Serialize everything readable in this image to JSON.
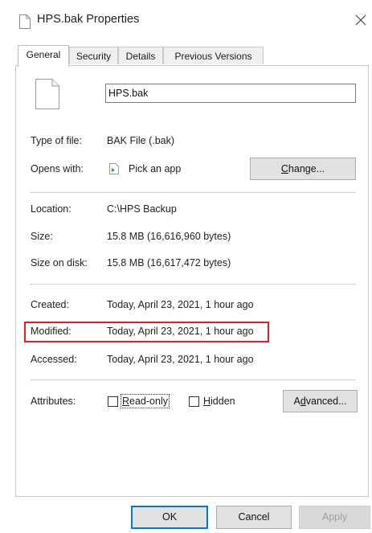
{
  "window": {
    "title": "HPS.bak Properties",
    "file_icon": "document-icon",
    "close_glyph": "✕"
  },
  "tabs": [
    {
      "label": "General",
      "active": true
    },
    {
      "label": "Security",
      "active": false
    },
    {
      "label": "Details",
      "active": false
    },
    {
      "label": "Previous Versions",
      "active": false
    }
  ],
  "general": {
    "filename": "HPS.bak",
    "type_label": "Type of file:",
    "type_value": "BAK File (.bak)",
    "opens_label": "Opens with:",
    "opens_value": "Pick an app",
    "change_button": {
      "pre": "",
      "key": "C",
      "post": "hange..."
    },
    "location_label": "Location:",
    "location_value": "C:\\HPS Backup",
    "size_label": "Size:",
    "size_value": "15.8 MB (16,616,960 bytes)",
    "size_on_disk_label": "Size on disk:",
    "size_on_disk_value": "15.8 MB (16,617,472 bytes)",
    "created_label": "Created:",
    "created_value": "Today, April 23, 2021, 1 hour ago",
    "modified_label": "Modified:",
    "modified_value": "Today, April 23, 2021, 1 hour ago",
    "accessed_label": "Accessed:",
    "accessed_value": "Today, April 23, 2021, 1 hour ago",
    "attributes_label": "Attributes:",
    "readonly": {
      "pre": "",
      "key": "R",
      "post": "ead-only",
      "checked": false
    },
    "hidden": {
      "pre": "",
      "key": "H",
      "post": "idden",
      "checked": false
    },
    "advanced_button": {
      "pre": "A",
      "key": "d",
      "post": "vanced..."
    }
  },
  "footer": {
    "ok": "OK",
    "cancel": "Cancel",
    "apply": "Apply"
  },
  "colors": {
    "highlight": "#e01e2a",
    "default_button_border": "#0078d7",
    "app_icon_green": "#2e9e3e"
  }
}
